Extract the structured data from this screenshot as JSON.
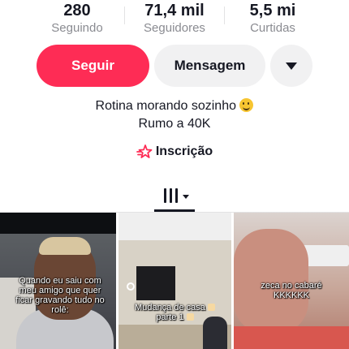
{
  "stats": [
    {
      "value": "280",
      "label": "Seguindo"
    },
    {
      "value": "71,4 mil",
      "label": "Seguidores"
    },
    {
      "value": "5,5 mi",
      "label": "Curtidas"
    }
  ],
  "actions": {
    "follow_label": "Seguir",
    "message_label": "Mensagem",
    "more_icon": "caret-down-icon"
  },
  "bio": {
    "line1": "Rotina morando sozinho",
    "line1_emoji": "smiling-face-emoji",
    "line2": "Rumo a 40K"
  },
  "subscription": {
    "label": "Inscrição",
    "icon": "subscription-star-icon"
  },
  "tabs": {
    "active_icon": "videos-grid-icon"
  },
  "videos": [
    {
      "caption": "Quando eu saiu com meu amigo que quer ficar gravando tudo no rolê:"
    },
    {
      "caption_line1": "Mudança de casa",
      "caption_line2": "parte 1"
    },
    {
      "caption_line1": "zeca no cabaré",
      "caption_line2": "KKKKKK"
    }
  ],
  "colors": {
    "accent": "#fe2c55",
    "text": "#161823",
    "muted": "#8a8b91",
    "button_bg": "#f1f1f2"
  }
}
